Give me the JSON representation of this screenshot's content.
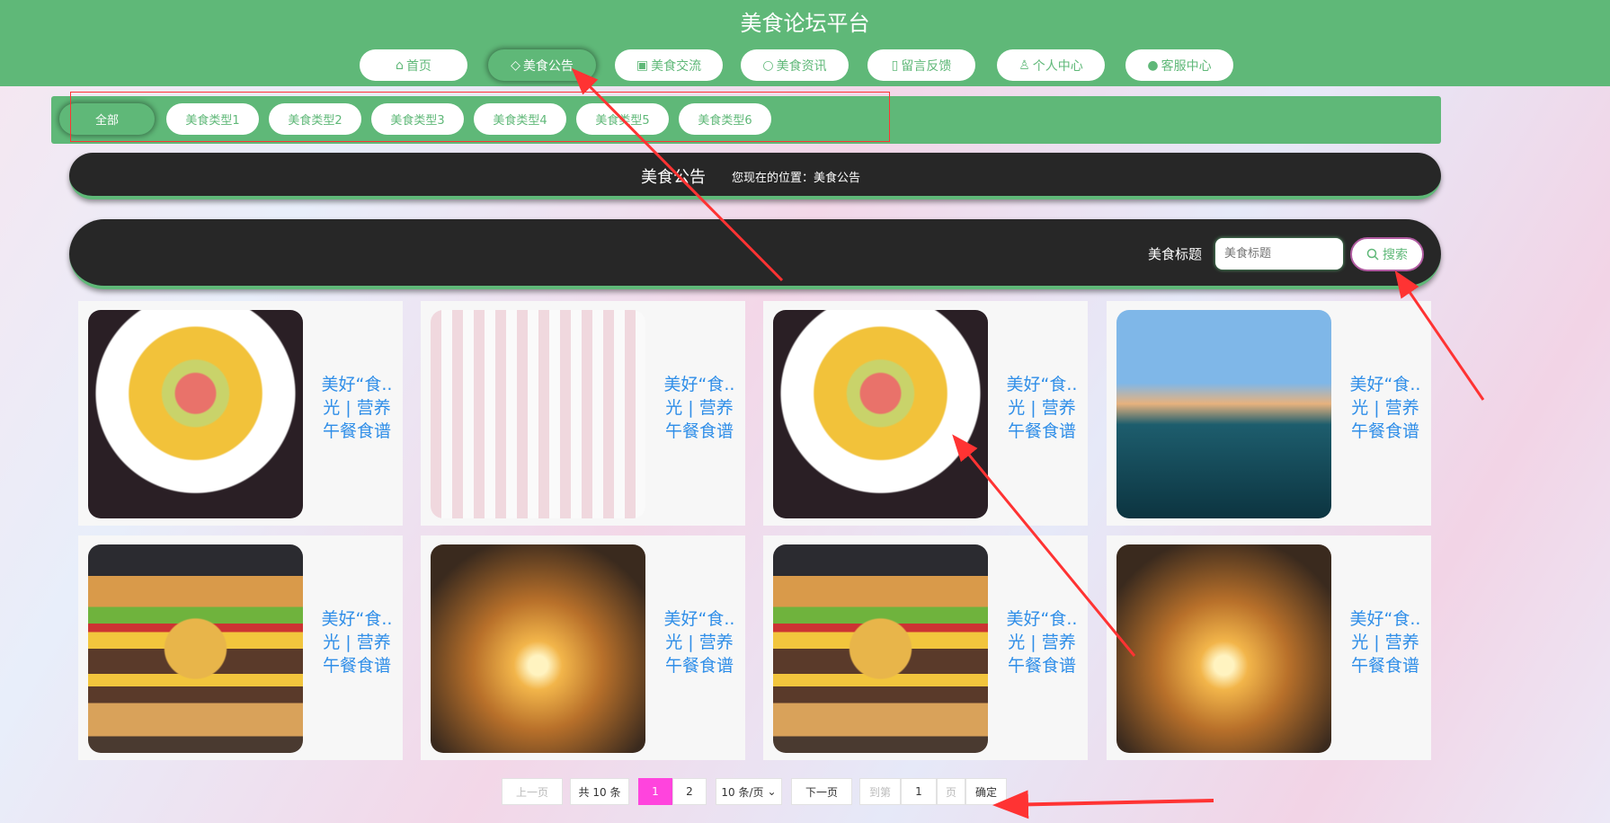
{
  "header": {
    "title": "美食论坛平台"
  },
  "nav": [
    {
      "label": "首页",
      "icon": "home-icon"
    },
    {
      "label": "美食公告",
      "icon": "tag-icon",
      "active": true
    },
    {
      "label": "美食交流",
      "icon": "gift-icon"
    },
    {
      "label": "美食资讯",
      "icon": "chat-icon"
    },
    {
      "label": "留言反馈",
      "icon": "note-icon"
    },
    {
      "label": "个人中心",
      "icon": "user-icon"
    },
    {
      "label": "客服中心",
      "icon": "wechat-icon"
    }
  ],
  "categories": [
    {
      "label": "全部",
      "active": true
    },
    {
      "label": "美食类型1"
    },
    {
      "label": "美食类型2"
    },
    {
      "label": "美食类型3"
    },
    {
      "label": "美食类型4"
    },
    {
      "label": "美食类型5"
    },
    {
      "label": "美食类型6"
    }
  ],
  "breadcrumb": {
    "title": "美食公告",
    "position": "您现在的位置：美食公告"
  },
  "search": {
    "label": "美食标题",
    "placeholder": "美食标题",
    "button": "搜索"
  },
  "cards": [
    {
      "title": "美好“食..光 | 营养午餐食谱",
      "image": "food-platter"
    },
    {
      "title": "美好“食..光 | 营养午餐食谱",
      "image": "kids-meal"
    },
    {
      "title": "美好“食..光 | 营养午餐食谱",
      "image": "food-platter"
    },
    {
      "title": "美好“食..光 | 营养午餐食谱",
      "image": "lake-island"
    },
    {
      "title": "美好“食..光 | 营养午餐食谱",
      "image": "burger"
    },
    {
      "title": "美好“食..光 | 营养午餐食谱",
      "image": "sunset-tree"
    },
    {
      "title": "美好“食..光 | 营养午餐食谱",
      "image": "burger"
    },
    {
      "title": "美好“食..光 | 营养午餐食谱",
      "image": "sunset-tree"
    }
  ],
  "pagination": {
    "prev": "上一页",
    "total": "共 10 条",
    "pages": [
      "1",
      "2"
    ],
    "current": "1",
    "page_size": "10 条/页",
    "next": "下一页",
    "goto_label": "到第",
    "goto_value": "1",
    "page_unit": "页",
    "confirm": "确定"
  },
  "colors": {
    "primary": "#5fb878",
    "dark_bar": "#272727",
    "current_page": "#ff44dd",
    "card_title": "#2f8ee8",
    "annotation": "#ff3333"
  }
}
